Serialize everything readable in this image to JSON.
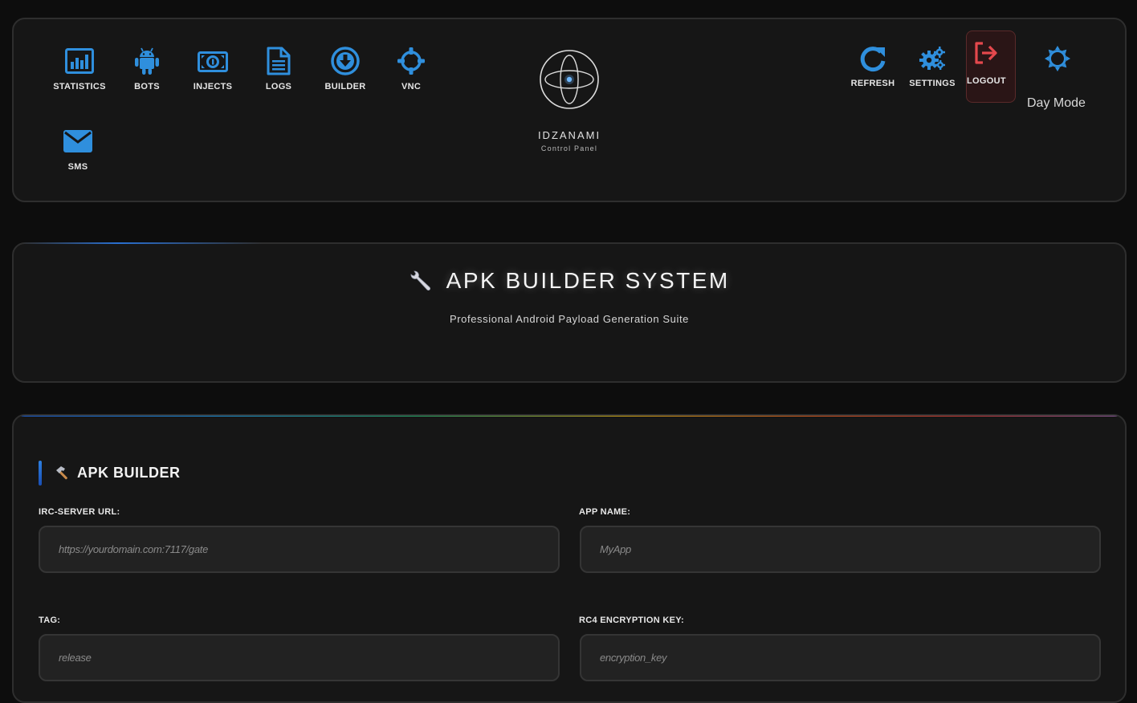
{
  "header": {
    "nav": [
      {
        "label": "STATISTICS",
        "icon": "statistics-icon"
      },
      {
        "label": "BOTS",
        "icon": "android-icon"
      },
      {
        "label": "INJECTS",
        "icon": "money-icon"
      },
      {
        "label": "LOGS",
        "icon": "document-icon"
      },
      {
        "label": "BUILDER",
        "icon": "download-circle-icon"
      },
      {
        "label": "VNC",
        "icon": "crosshair-icon"
      },
      {
        "label": "SMS",
        "icon": "envelope-icon"
      }
    ],
    "logo": {
      "title": "IDZANAMI",
      "subtitle": "Control Panel"
    },
    "actions": {
      "refresh": "REFRESH",
      "settings": "SETTINGS",
      "logout": "LOGOUT",
      "day_mode": "Day Mode"
    }
  },
  "banner": {
    "title": "APK BUILDER SYSTEM",
    "subtitle": "Professional Android Payload Generation Suite",
    "icon": "wrench-icon"
  },
  "builder": {
    "title": "APK BUILDER",
    "icon": "hammer-icon",
    "fields": {
      "irc_url": {
        "label": "IRC-SERVER URL:",
        "placeholder": "https://yourdomain.com:7117/gate",
        "value": ""
      },
      "app_name": {
        "label": "APP NAME:",
        "placeholder": "MyApp",
        "value": ""
      },
      "tag": {
        "label": "TAG:",
        "placeholder": "release",
        "value": ""
      },
      "rc4_key": {
        "label": "RC4 ENCRYPTION KEY:",
        "placeholder": "encryption_key",
        "value": ""
      }
    }
  },
  "colors": {
    "accent": "#2f8fdd",
    "logout": "#e5484d",
    "background": "#0d0d0d",
    "panel": "#161616"
  }
}
